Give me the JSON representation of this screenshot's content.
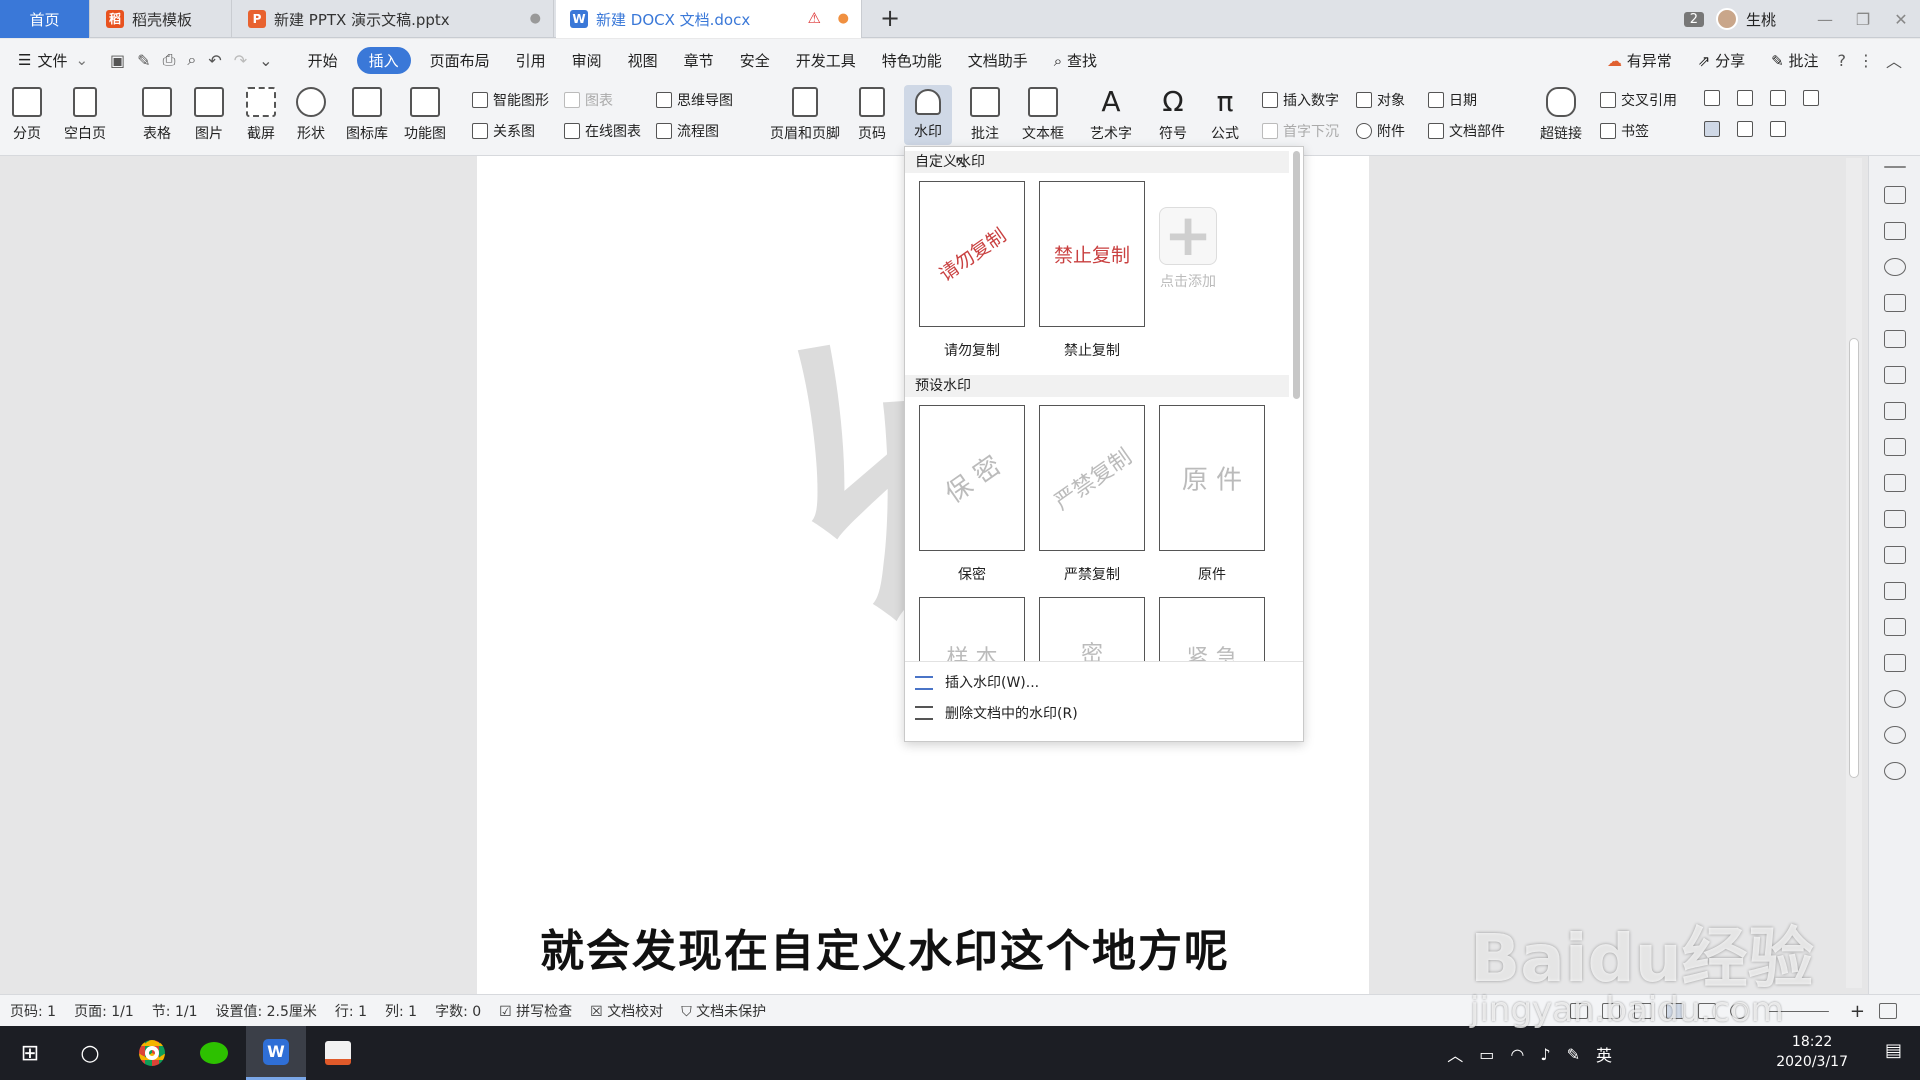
{
  "tabs": {
    "home": "首页",
    "daoke": "稻壳模板",
    "pptx": "新建 PPTX 演示文稿.pptx",
    "docx": "新建 DOCX 文档.docx",
    "add": "+",
    "count": "2",
    "user": "生桃"
  },
  "menu": {
    "file": "文件",
    "items": [
      "开始",
      "插入",
      "页面布局",
      "引用",
      "审阅",
      "视图",
      "章节",
      "安全",
      "开发工具",
      "特色功能",
      "文档助手"
    ],
    "search": "查找",
    "right": [
      "有异常",
      "分享",
      "批注"
    ]
  },
  "ribbon": {
    "page_break": "分页",
    "blank_page": "空白页",
    "table": "表格",
    "picture": "图片",
    "screenshot": "截屏",
    "shape": "形状",
    "icon_lib": "图标库",
    "func_chart": "功能图",
    "smart_shape": "智能图形",
    "chart": "图表",
    "mind_map": "思维导图",
    "relation": "关系图",
    "online_chart": "在线图表",
    "flow": "流程图",
    "header_footer": "页眉和页脚",
    "page_num": "页码",
    "watermark": "水印",
    "comment": "批注",
    "textbox": "文本框",
    "wordart": "艺术字",
    "symbol": "符号",
    "formula": "公式",
    "insert_num": "插入数字",
    "object": "对象",
    "date": "日期",
    "dropcap": "首字下沉",
    "attach": "附件",
    "doc_parts": "文档部件",
    "hyperlink": "超链接",
    "crossref": "交叉引用",
    "bookmark": "书签"
  },
  "watermark_panel": {
    "custom_header": "自定义水印",
    "custom": [
      {
        "text": "请勿复制",
        "label": "请勿复制",
        "color": "#c94040"
      },
      {
        "text": "禁止复制",
        "label": "禁止复制",
        "color": "#c94040"
      }
    ],
    "add_label": "点击添加",
    "preset_header": "预设水印",
    "preset": [
      {
        "text": "保 密",
        "label": "保密"
      },
      {
        "text": "严禁复制",
        "label": "严禁复制"
      },
      {
        "text": "原 件",
        "label": "原件"
      }
    ],
    "preset_row2": [
      "样 本",
      "密",
      "紧 急"
    ],
    "insert": "插入水印(W)...",
    "delete": "删除文档中的水印(R)"
  },
  "doc": {
    "watermark_char": "绝",
    "subtitle": "就会发现在自定义水印这个地方呢"
  },
  "statusbar": {
    "page": "页码: 1",
    "pages": "页面: 1/1",
    "section": "节: 1/1",
    "setting": "设置值: 2.5厘米",
    "row": "行: 1",
    "col": "列: 1",
    "words": "字数: 0",
    "spell": "拼写检查",
    "proof": "文档校对",
    "protect": "文档未保护"
  },
  "taskbar": {
    "time": "18:22",
    "date": "2020/3/17",
    "lang": "英"
  },
  "overlay": {
    "baidu": "Baidu经验",
    "url": "jingyan.baidu.com"
  }
}
